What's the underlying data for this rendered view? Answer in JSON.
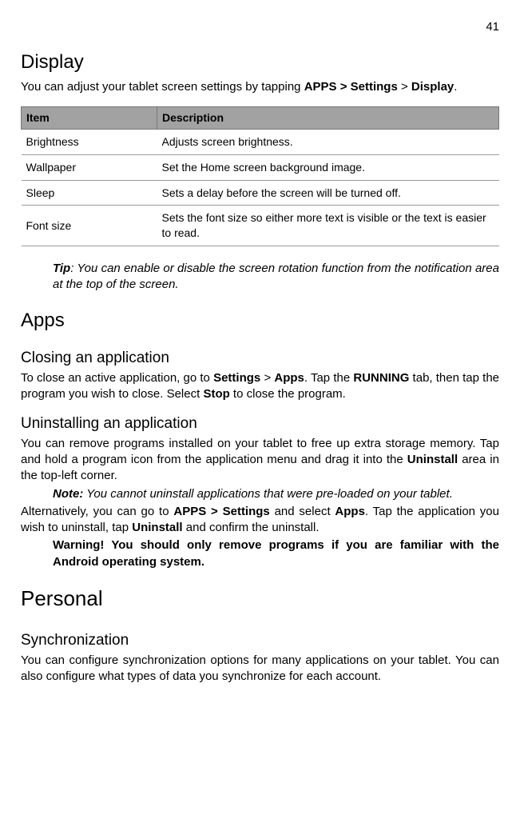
{
  "page_number": "41",
  "section_display": {
    "heading": "Display",
    "intro_pre": "You can adjust your tablet screen settings by tapping ",
    "intro_bold1": "APPS > Settings",
    "intro_mid": " > ",
    "intro_bold2": "Display",
    "intro_post": "."
  },
  "table": {
    "col1": "Item",
    "col2": "Description",
    "rows": [
      {
        "item": "Brightness",
        "desc": "Adjusts screen brightness."
      },
      {
        "item": "Wallpaper",
        "desc": "Set the Home screen background image."
      },
      {
        "item": "Sleep",
        "desc": "Sets a delay before the screen will be turned off."
      },
      {
        "item": "Font size",
        "desc": "Sets the font size so either more text is visible or the text is easier to read."
      }
    ]
  },
  "tip": {
    "label": "Tip",
    "text": ": You can enable or disable the screen rotation function from the notification area at the top of the screen."
  },
  "apps": {
    "heading": "Apps",
    "closing": {
      "heading": "Closing an application",
      "p_pre": "To close an active application, go to ",
      "b1": "Settings",
      "mid1": " > ",
      "b2": "Apps",
      "mid2": ". Tap the ",
      "b3": "RUNNING",
      "mid3": " tab, then tap the program you wish to close. Select ",
      "b4": "Stop",
      "post": " to close the program."
    },
    "uninstall": {
      "heading": "Uninstalling an application",
      "p1_pre": "You can remove programs installed on your tablet to free up extra storage memory. Tap and hold a program icon from the application menu and drag it into the ",
      "p1_b": "Uninstall",
      "p1_post": " area in the top-left corner.",
      "note_label": "Note:",
      "note_text": " You cannot uninstall applications that were pre-loaded on your tablet.",
      "p2_pre": "Alternatively, you can go to ",
      "p2_b1": "APPS > Settings",
      "p2_mid1": " and select ",
      "p2_b2": "Apps",
      "p2_mid2": ". Tap the application you wish to uninstall, tap ",
      "p2_b3": "Uninstall",
      "p2_post": " and confirm the uninstall.",
      "warn": "Warning! You should only remove programs if you are familiar with the Android operating system."
    }
  },
  "personal": {
    "heading": "Personal",
    "sync": {
      "heading": "Synchronization",
      "p": "You can configure synchronization options for many applications on your tablet. You can also configure what types of data you synchronize for each account."
    }
  }
}
